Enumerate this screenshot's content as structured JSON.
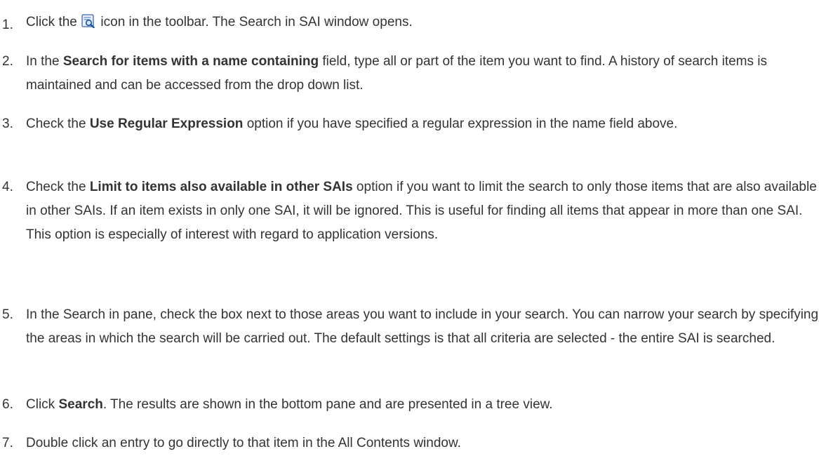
{
  "steps": [
    {
      "number": "1.",
      "before": "Click the ",
      "icon": "search-sai-icon",
      "after": " icon in the toolbar. The Search in SAI window opens."
    },
    {
      "number": "2.",
      "before": "In the ",
      "bold": "Search for items with a name containing",
      "after": " field, type all or part of the item you want to find. A history of search items is maintained and can be accessed from the drop down list."
    },
    {
      "number": "3.",
      "before": "Check the ",
      "bold": "Use Regular Expression",
      "after": " option if you have specified a regular expression in the name field above."
    },
    {
      "number": "4.",
      "before": "Check the ",
      "bold": "Limit to items also available in other SAIs",
      "after": " option if you want to limit the search to only those items that are also available in other SAIs. If an item exists in only one SAI, it will be ignored. This is useful for finding all items that appear in more than one SAI. This option is especially of interest with regard to application versions."
    },
    {
      "number": "5.",
      "text": "In the Search in pane, check the box next to those areas you want to include in your search. You can narrow your search by specifying the areas in which the search will be carried out. The default settings is that all criteria are selected - the entire SAI is searched."
    },
    {
      "number": "6.",
      "before": "Click ",
      "bold": "Search",
      "after": ". The results are shown in the bottom pane and are presented in a tree view."
    },
    {
      "number": "7.",
      "text": "Double click an entry to go directly to that item in the All Contents window."
    }
  ]
}
